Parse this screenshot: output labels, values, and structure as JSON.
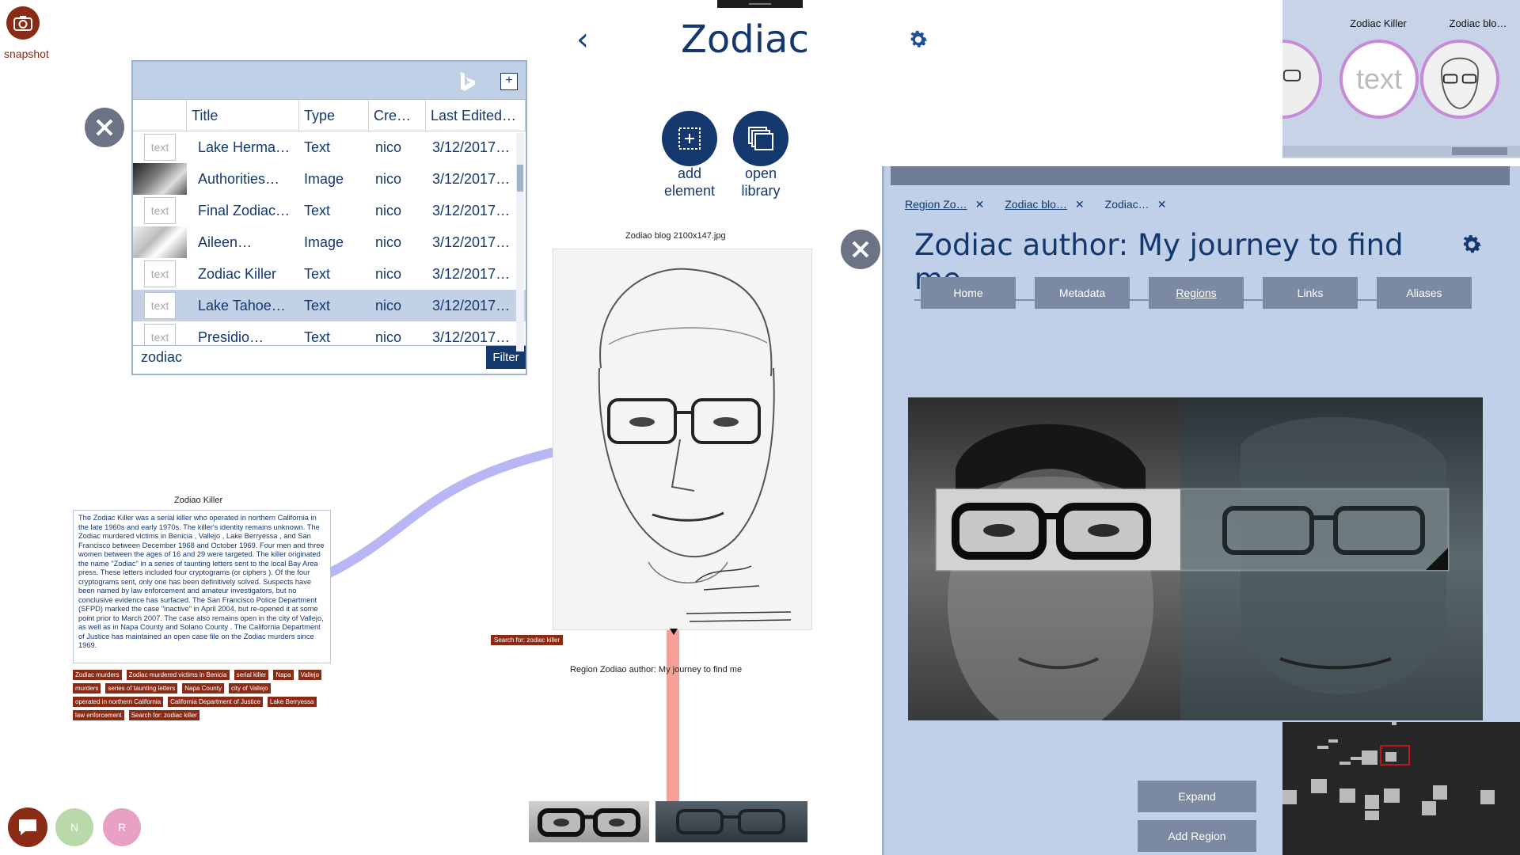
{
  "app": {
    "snapshot_label": "snapshot",
    "workspace_title": "Zodiac",
    "back_glyph": "‹",
    "add_element_label_1": "add",
    "add_element_label_2": "element",
    "open_library_label_1": "open",
    "open_library_label_2": "library"
  },
  "library": {
    "columns": [
      "Title",
      "Type",
      "Cre…",
      "Last Edited…"
    ],
    "rows": [
      {
        "thumb": "text",
        "title": "Lake Herma…",
        "type": "Text",
        "creator": "nico",
        "edited": "3/12/2017…"
      },
      {
        "thumb": "image",
        "title": "Authorities…",
        "type": "Image",
        "creator": "nico",
        "edited": "3/12/2017…"
      },
      {
        "thumb": "text",
        "title": "Final Zodiac…",
        "type": "Text",
        "creator": "nico",
        "edited": "3/12/2017…"
      },
      {
        "thumb": "image",
        "title": "Aileen…",
        "type": "Image",
        "creator": "nico",
        "edited": "3/12/2017…"
      },
      {
        "thumb": "text",
        "title": "Zodiac Killer",
        "type": "Text",
        "creator": "nico",
        "edited": "3/12/2017…"
      },
      {
        "thumb": "text",
        "title": "Lake Tahoe…",
        "type": "Text",
        "creator": "nico",
        "edited": "3/12/2017…"
      },
      {
        "thumb": "text",
        "title": "Presidio…",
        "type": "Text",
        "creator": "nico",
        "edited": "3/12/2017…"
      }
    ],
    "text_thumb_label": "text",
    "add_label": "+",
    "search_value": "zodiac",
    "filter_label": "Filter"
  },
  "image_node": {
    "title": "Zodiao blog 2100x147.jpg",
    "search_tag": "Search for: zodiac killer",
    "region_title": "Region Zodiao author: My journey to find me"
  },
  "text_node": {
    "title": "Zodiao Killer",
    "body": "The Zodiac Killer was a serial killer who operated in northern California in the late 1960s and early 1970s. The killer's identity remains unknown. The Zodiac murdered victims in Benicia , Vallejo , Lake Berryessa , and San Francisco between December 1968 and October 1969. Four men and three women between the ages of 16 and 29 were targeted. The killer originated the name \"Zodiac\" in a series of taunting letters sent to the local Bay Area press. These letters included four cryptograms (or ciphers ). Of the four cryptograms sent, only one has been definitively solved. Suspects have been named by law enforcement and amateur investigators, but no conclusive evidence has surfaced. The San Francisco Police Department (SFPD) marked the case \"inactive\" in April 2004, but re-opened it at some point prior to March 2007. The case also remains open in the city of Vallejo, as well as in Napa County and Solano County . The California Department of Justice has maintained an open case file on the Zodiac murders since 1969.",
    "tags": [
      "Zodiac murders",
      "Zodiac murdered victims in Benicia",
      "serial killer",
      "Napa",
      "Vallejo",
      "murders",
      "series of taunting letters",
      "Napa County",
      "city of Vallejo",
      "operated in northern California",
      "California Department of Justice",
      "Lake Berryessa",
      "law enforcement",
      "Search for: zodiac killer"
    ]
  },
  "users": {
    "n": "N",
    "r": "R"
  },
  "recent": {
    "items": [
      {
        "label": "…",
        "kind": "image"
      },
      {
        "label": "Zodiac Killer",
        "kind": "text"
      },
      {
        "label": "Zodiac blo…",
        "kind": "image"
      }
    ],
    "text_circle_label": "text"
  },
  "detail": {
    "tabs": [
      "Region Zo…",
      "Zodiac blo…",
      "Zodiac…"
    ],
    "close_glyph": "✕",
    "title": "Zodiac author: My journey to find me",
    "nav": [
      "Home",
      "Metadata",
      "Regions",
      "Links",
      "Aliases"
    ],
    "active_nav": "Regions",
    "expand_label": "Expand",
    "add_region_label": "Add Region"
  },
  "colors": {
    "brand_dark": "#13386e",
    "accent_red": "#8a2b16",
    "panel_blue": "#bfd0e8",
    "link_purple": "#b9b6f5",
    "link_salmon": "#f5a19a"
  }
}
